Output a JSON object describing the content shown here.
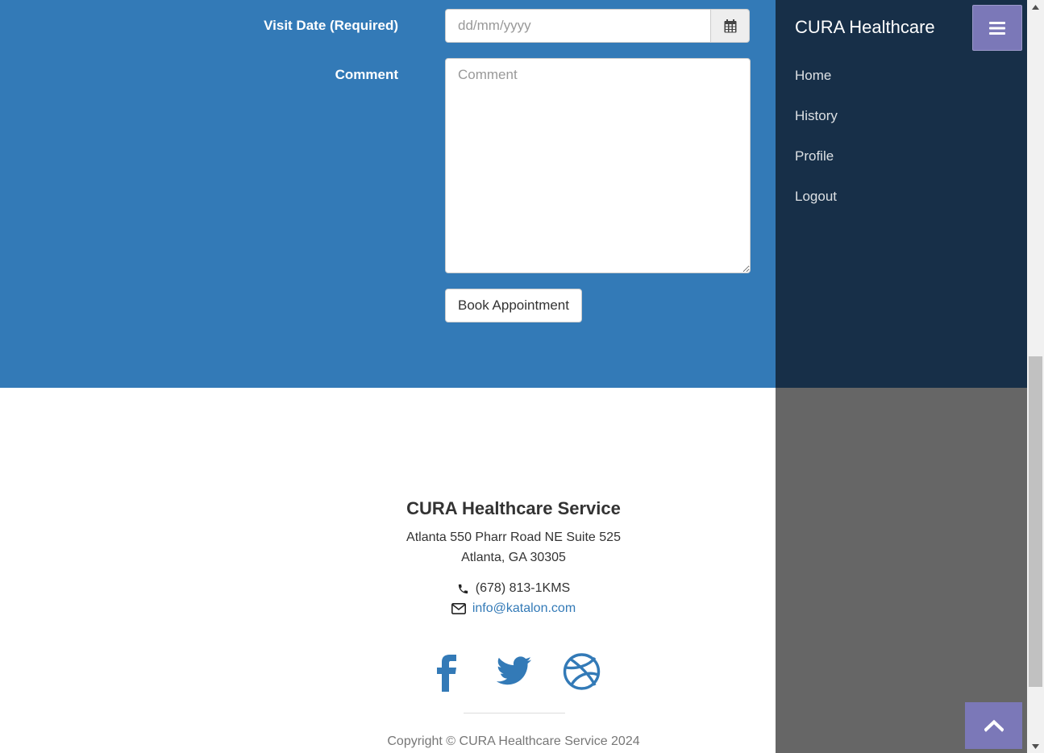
{
  "form": {
    "visit_date_label": "Visit Date (Required)",
    "visit_date_placeholder": "dd/mm/yyyy",
    "visit_date_value": "",
    "comment_label": "Comment",
    "comment_placeholder": "Comment",
    "comment_value": "",
    "book_button_label": "Book Appointment",
    "calendar_icon": "calendar-icon"
  },
  "sidebar": {
    "brand": "CURA Healthcare",
    "menu_icon": "bars-icon",
    "items": [
      {
        "label": "Home"
      },
      {
        "label": "History"
      },
      {
        "label": "Profile"
      },
      {
        "label": "Logout"
      }
    ]
  },
  "footer": {
    "title": "CURA Healthcare Service",
    "address_line1": "Atlanta 550 Pharr Road NE Suite 525",
    "address_line2": "Atlanta, GA 30305",
    "phone": "(678) 813-1KMS",
    "email": "info@katalon.com",
    "social_icons": [
      "facebook-icon",
      "twitter-icon",
      "dribbble-icon"
    ],
    "copyright": "Copyright © CURA Healthcare Service 2024"
  },
  "colors": {
    "primary": "#337ab7",
    "sidebar": "#172f48",
    "accent": "#7b78b8"
  }
}
